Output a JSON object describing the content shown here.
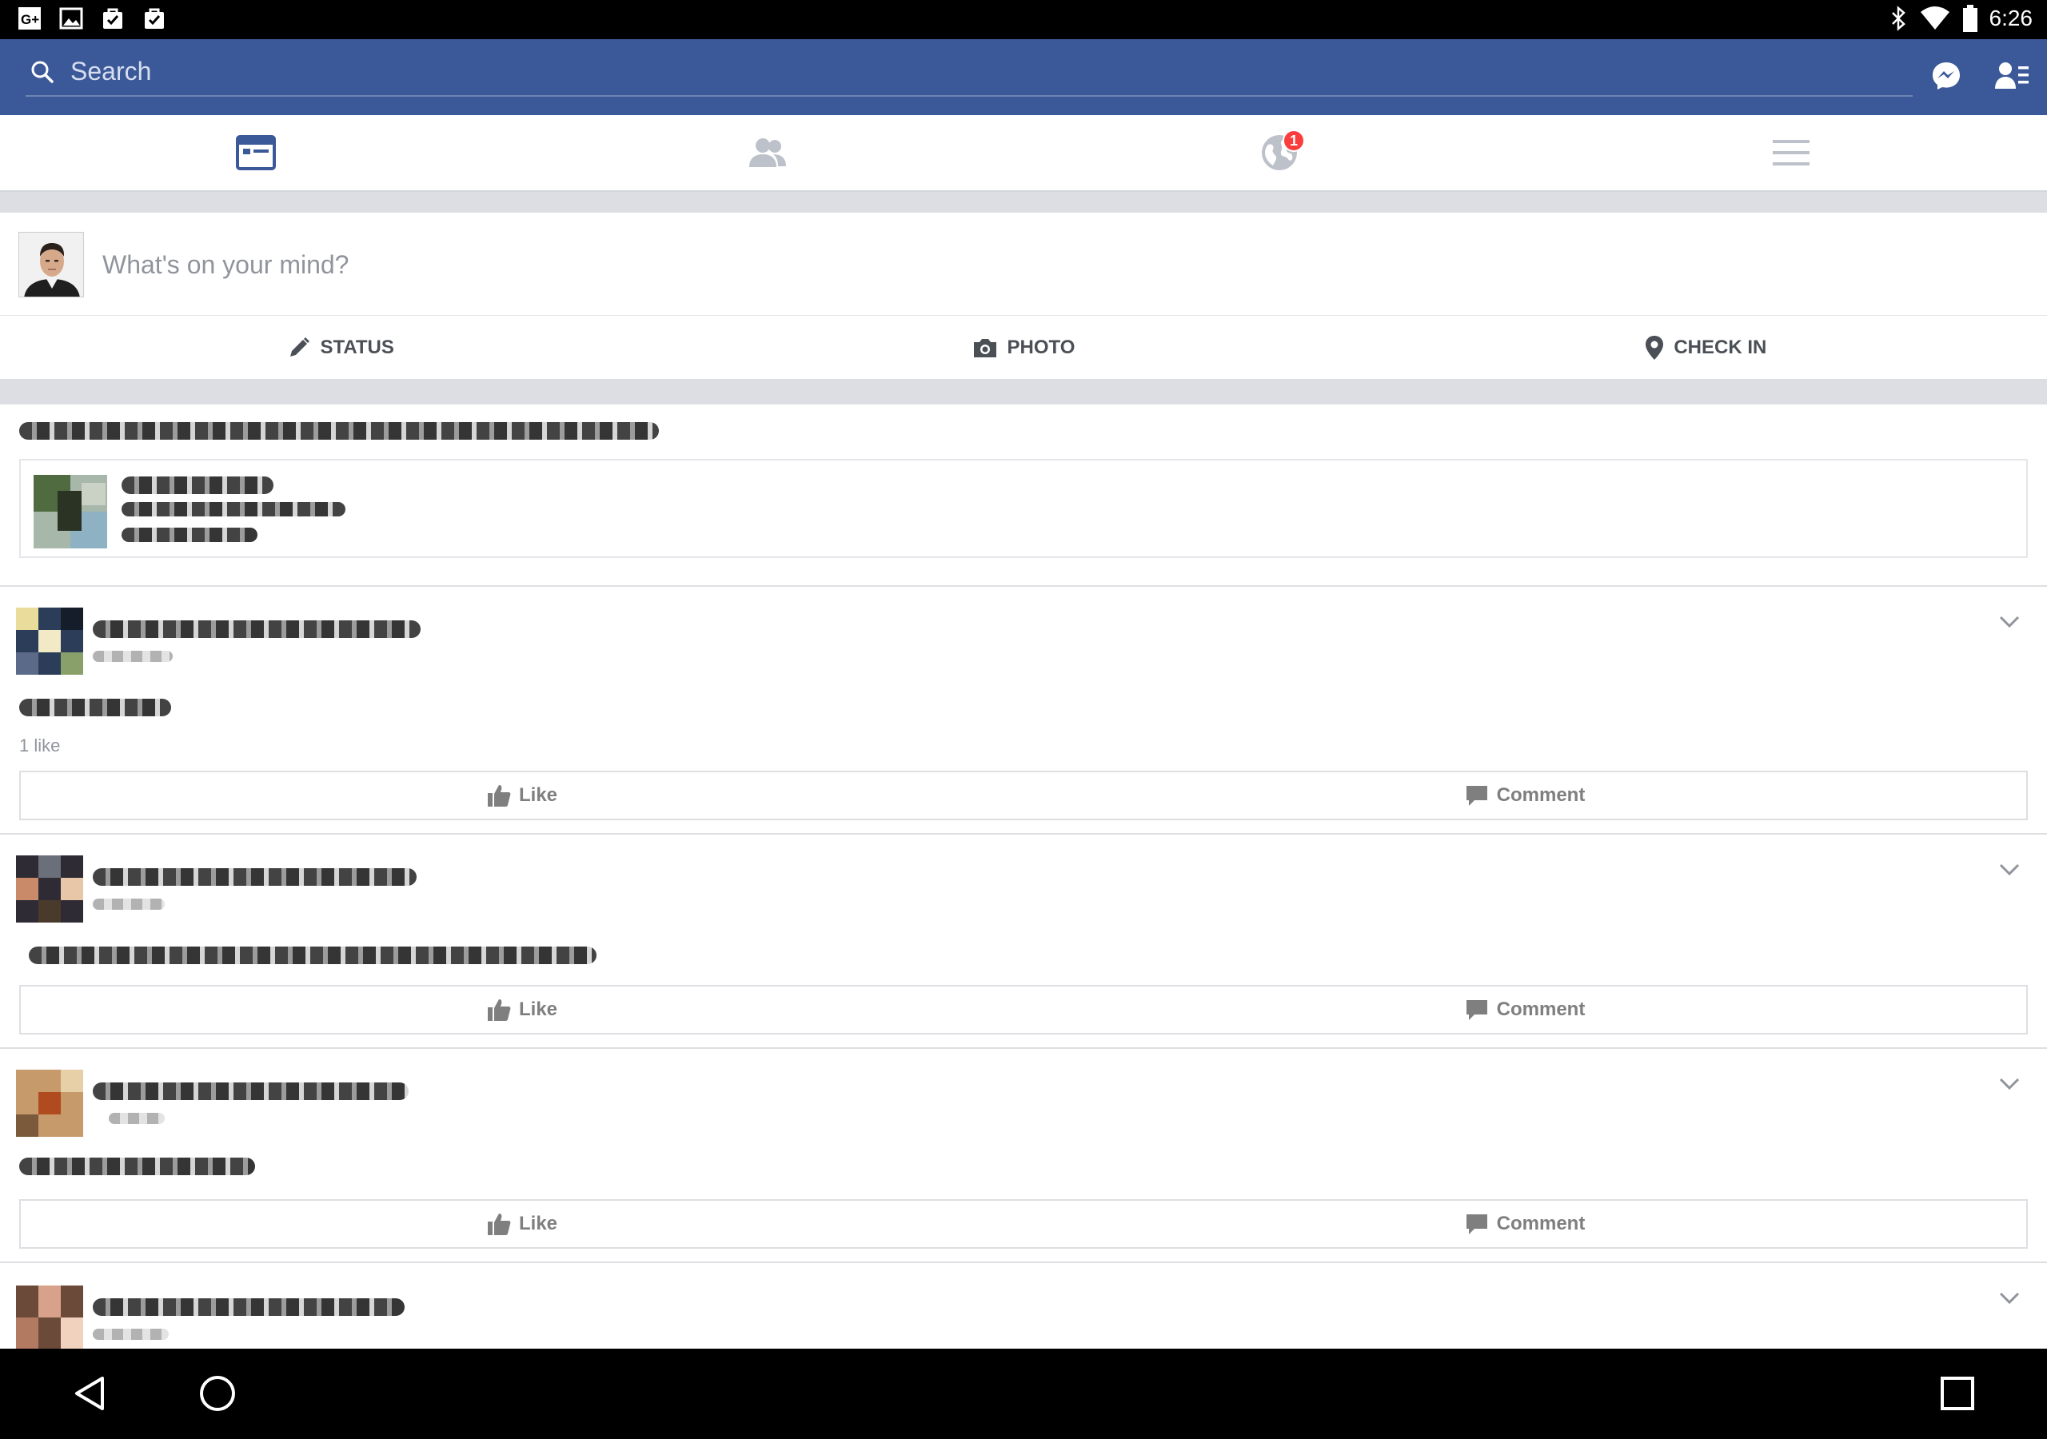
{
  "status_bar": {
    "time": "6:26",
    "left_icons": [
      "google-plus-icon",
      "image-icon",
      "shopping-bag-check-icon",
      "shopping-bag-check-icon"
    ],
    "right_icons": [
      "bluetooth-icon",
      "wifi-icon",
      "battery-icon"
    ]
  },
  "header": {
    "search_placeholder": "Search",
    "messenger_icon": "messenger-icon",
    "friends_list_icon": "friends-list-icon",
    "color": "#3b5998"
  },
  "tabs": [
    {
      "name": "news-feed",
      "icon": "news-feed-icon",
      "active": true
    },
    {
      "name": "friend-requests",
      "icon": "friends-icon",
      "active": false
    },
    {
      "name": "notifications",
      "icon": "globe-icon",
      "active": false,
      "badge": "1"
    },
    {
      "name": "more",
      "icon": "menu-icon",
      "active": false
    }
  ],
  "composer": {
    "placeholder": "What's on your mind?",
    "actions": [
      {
        "label": "STATUS",
        "icon": "pencil-icon"
      },
      {
        "label": "PHOTO",
        "icon": "camera-icon"
      },
      {
        "label": "CHECK IN",
        "icon": "location-pin-icon"
      }
    ]
  },
  "feed": {
    "like_label": "Like",
    "comment_label": "Comment",
    "stories": [
      {
        "likes": "1 like"
      }
    ]
  },
  "nav_bar": {
    "icons": [
      "back-icon",
      "home-icon",
      "recents-icon"
    ]
  }
}
